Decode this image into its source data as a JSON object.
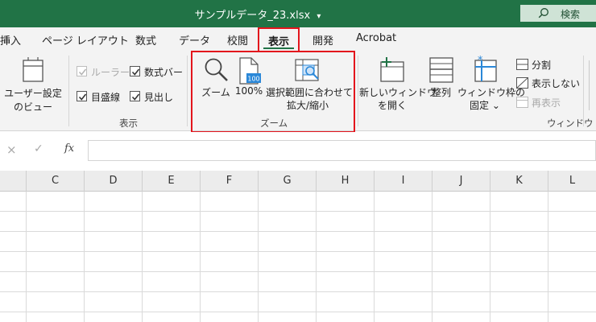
{
  "titlebar": {
    "title": "サンプルデータ_23.xlsx",
    "title_caret": "▾",
    "search_label": "検索"
  },
  "tabs": {
    "insert": "挿入",
    "page_layout": "ページ レイアウト",
    "formulas": "数式",
    "data": "データ",
    "review": "校閲",
    "view": "表示",
    "developer": "開発",
    "acrobat": "Acrobat"
  },
  "ribbon": {
    "workbook_views": {
      "custom_view_line1": "ユーザー設定",
      "custom_view_line2": "のビュー"
    },
    "show": {
      "ruler": "ルーラー",
      "gridlines": "目盛線",
      "formula_bar": "数式バー",
      "headings": "見出し",
      "group_label": "表示",
      "ruler_checked": true,
      "ruler_disabled": true,
      "gridlines_checked": true,
      "formula_bar_checked": true,
      "headings_checked": true
    },
    "zoom": {
      "zoom": "ズーム",
      "hundred": "100%",
      "zoom_icon_badge": "100",
      "zoom_to_selection_line1": "選択範囲に合わせて",
      "zoom_to_selection_line2": "拡大/縮小",
      "group_label": "ズーム"
    },
    "window": {
      "new_window_line1": "新しいウィンドウ",
      "new_window_line2": "を開く",
      "arrange": "整列",
      "freeze_line1": "ウィンドウ枠の",
      "freeze_line2": "固定",
      "freeze_caret": "⌄",
      "split": "分割",
      "hide": "表示しない",
      "unhide": "再表示",
      "group_label": "ウィンドウ"
    }
  },
  "formula_bar": {
    "cancel": "×",
    "enter": "✓",
    "fx": "fx",
    "value": ""
  },
  "grid": {
    "columns": [
      "C",
      "D",
      "E",
      "F",
      "G",
      "H",
      "I",
      "J",
      "K",
      "L"
    ]
  },
  "colors": {
    "brand_green": "#217346",
    "highlight_red": "#e3151c",
    "icon_blue": "#2b88d8"
  },
  "icons": [
    "search-icon",
    "custom-view-icon",
    "zoom-icon",
    "zoom-100-icon",
    "zoom-to-selection-icon",
    "new-window-icon",
    "arrange-icon",
    "freeze-panes-icon",
    "split-icon",
    "hide-icon",
    "unhide-icon",
    "checkmark-icon"
  ]
}
